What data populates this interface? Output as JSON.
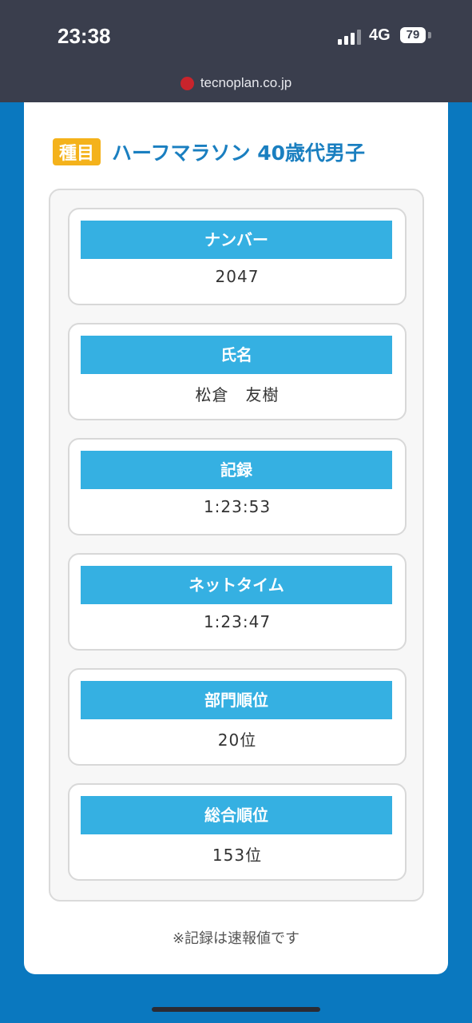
{
  "status_bar": {
    "time": "23:38",
    "network": "4G",
    "battery": "79"
  },
  "browser": {
    "url": "tecnoplan.co.jp"
  },
  "header": {
    "badge": "種目",
    "title": "ハーフマラソン 40歳代男子"
  },
  "results": [
    {
      "label": "ナンバー",
      "value": "2047"
    },
    {
      "label": "氏名",
      "value": "松倉　友樹"
    },
    {
      "label": "記録",
      "value": "1:23:53"
    },
    {
      "label": "ネットタイム",
      "value": "1:23:47"
    },
    {
      "label": "部門順位",
      "value": "20位"
    },
    {
      "label": "総合順位",
      "value": "153位"
    }
  ],
  "note": "※記録は速報値です",
  "colors": {
    "page_background": "#0a78bf",
    "status_bar": "#3a3e4d",
    "badge": "#f4b21b",
    "title": "#1a7fc0",
    "label_bar": "#35b0e2"
  }
}
